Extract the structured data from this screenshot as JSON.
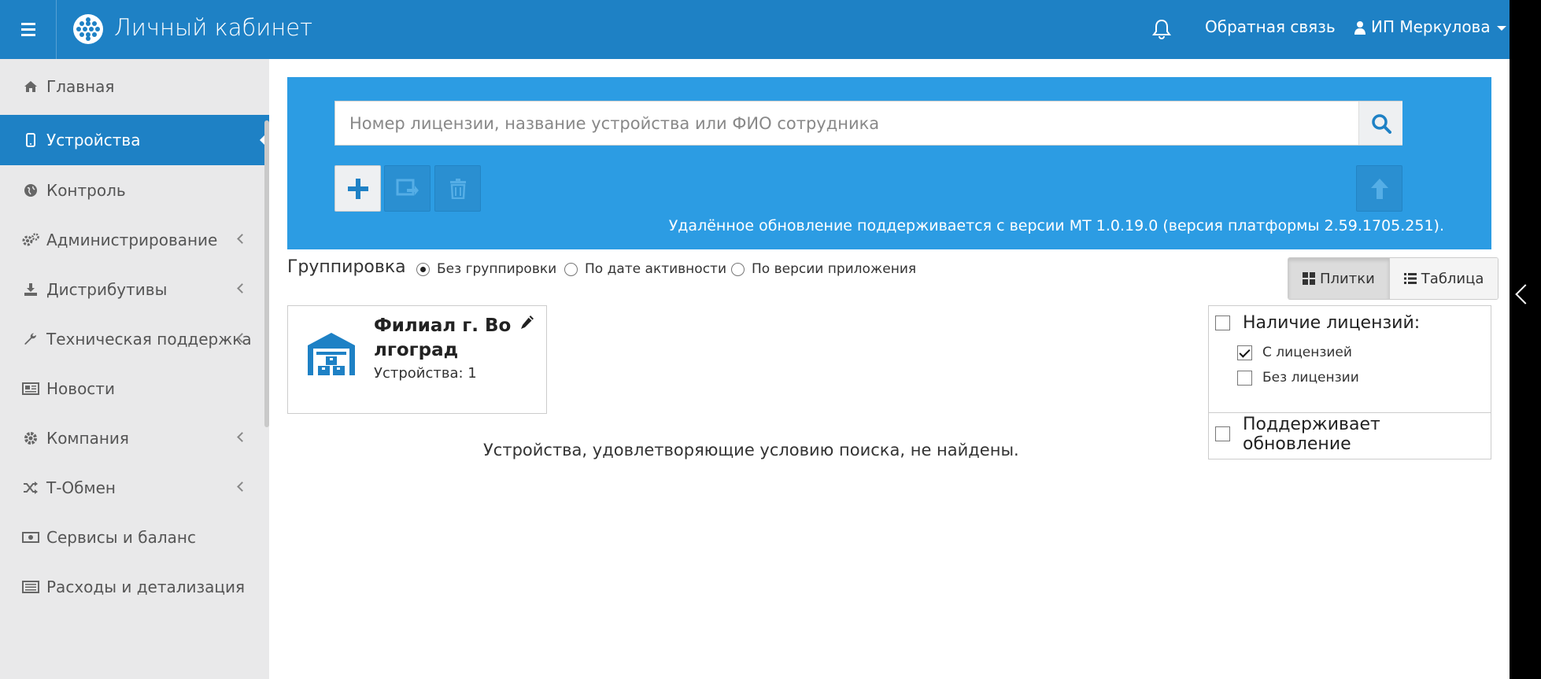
{
  "header": {
    "title": "Личный кабинет",
    "feedback": "Обратная связь",
    "user": "ИП Меркулова",
    "accent": "#1e81c5"
  },
  "sidebar": {
    "items": [
      {
        "label": "Главная",
        "icon": "home-icon",
        "active": false,
        "expandable": false
      },
      {
        "label": "Устройства",
        "icon": "mobile-icon",
        "active": true,
        "expandable": false
      },
      {
        "label": "Контроль",
        "icon": "globe-icon",
        "active": false,
        "expandable": false
      },
      {
        "label": "Администрирование",
        "icon": "gears-icon",
        "active": false,
        "expandable": true
      },
      {
        "label": "Дистрибутивы",
        "icon": "download-icon",
        "active": false,
        "expandable": true
      },
      {
        "label": "Техническая поддержка",
        "icon": "wrench-icon",
        "active": false,
        "expandable": true
      },
      {
        "label": "Новости",
        "icon": "newspaper-icon",
        "active": false,
        "expandable": false
      },
      {
        "label": "Компания",
        "icon": "gear-icon",
        "active": false,
        "expandable": true
      },
      {
        "label": "Т-Обмен",
        "icon": "shuffle-icon",
        "active": false,
        "expandable": true
      },
      {
        "label": "Сервисы и баланс",
        "icon": "money-icon",
        "active": false,
        "expandable": false
      },
      {
        "label": "Расходы и детализация",
        "icon": "list-alt-icon",
        "active": false,
        "expandable": false
      }
    ]
  },
  "search": {
    "placeholder": "Номер лицензии, название устройства или ФИО сотрудника",
    "value": ""
  },
  "notice": "Удалённое обновление поддерживается с версии МТ 1.0.19.0 (версия платформы 2.59.1705.251).",
  "grouping": {
    "label": "Группировка",
    "options": [
      {
        "label": "Без группировки",
        "selected": true
      },
      {
        "label": "По дате активности",
        "selected": false
      },
      {
        "label": "По версии приложения",
        "selected": false
      }
    ]
  },
  "view": {
    "tiles": "Плитки",
    "table": "Таблица",
    "active": "tiles"
  },
  "card": {
    "title": "Филиал г. Волгоград",
    "devices": "Устройства: 1"
  },
  "empty_message": "Устройства, удовлетворяющие условию поиска, не найдены.",
  "filters": {
    "license": {
      "label": "Наличие лицензий:",
      "checked": false,
      "options": [
        {
          "label": "С лицензией",
          "checked": true
        },
        {
          "label": "Без лицензии",
          "checked": false
        }
      ]
    },
    "update": {
      "label": "Поддерживает обновление",
      "checked": false
    }
  }
}
